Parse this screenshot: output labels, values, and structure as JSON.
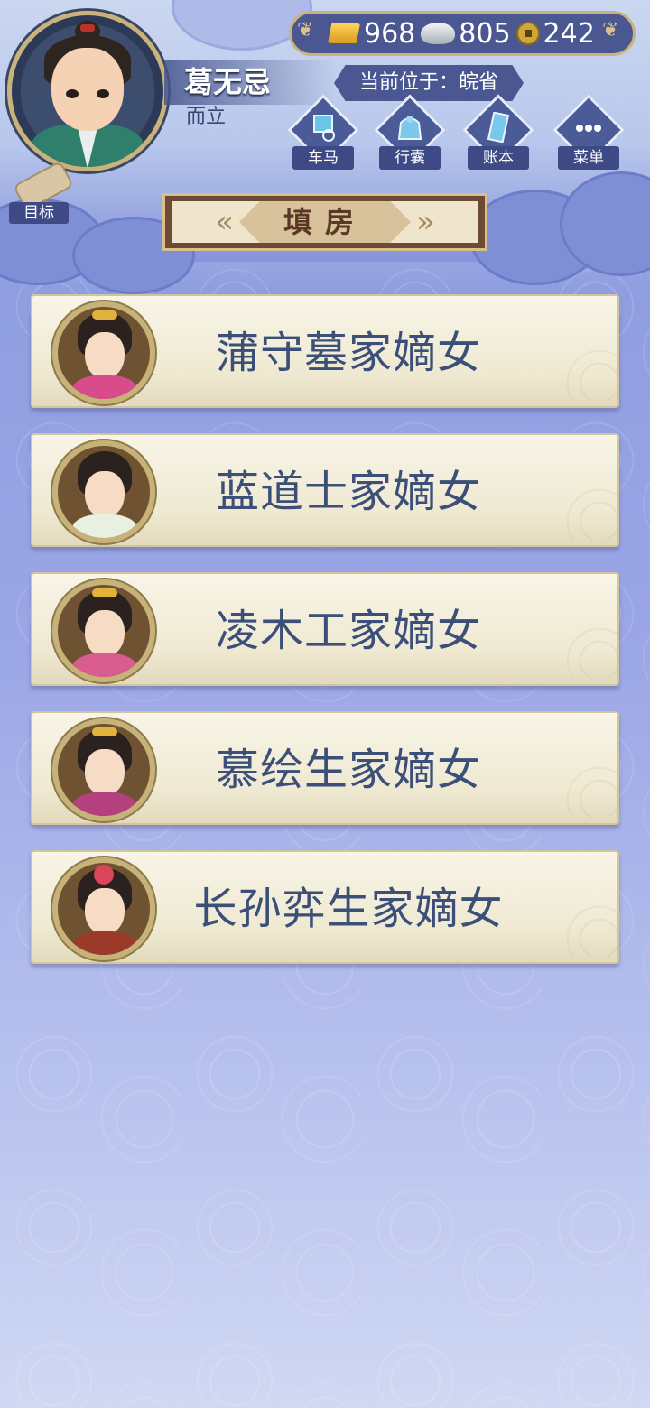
{
  "header": {
    "player_name": "葛无忌",
    "player_title": "而立",
    "location": "当前位于：皖省"
  },
  "currency": {
    "gold": "968",
    "silver": "805",
    "copper": "242"
  },
  "menu": [
    {
      "label": "车马",
      "icon": "carriage-icon"
    },
    {
      "label": "行囊",
      "icon": "bag-icon"
    },
    {
      "label": "账本",
      "icon": "ledger-icon"
    },
    {
      "label": "菜单",
      "icon": "more-icon"
    }
  ],
  "goal": {
    "label": "目标",
    "icon": "scroll-icon"
  },
  "section": {
    "title": "填房"
  },
  "brides": [
    {
      "name": "蒲守墓家嫡女",
      "robe_color": "#d94c8c"
    },
    {
      "name": "蓝道士家嫡女",
      "robe_color": "#e8f0e0"
    },
    {
      "name": "凌木工家嫡女",
      "robe_color": "#d95c8e"
    },
    {
      "name": "慕绘生家嫡女",
      "robe_color": "#b4407e"
    },
    {
      "name": "长孙弈生家嫡女",
      "robe_color": "#9c3a2a"
    }
  ],
  "colors": {
    "accent_gold": "#c9b37a",
    "panel_blue": "#4a5790",
    "name_text": "#3b4f78"
  }
}
